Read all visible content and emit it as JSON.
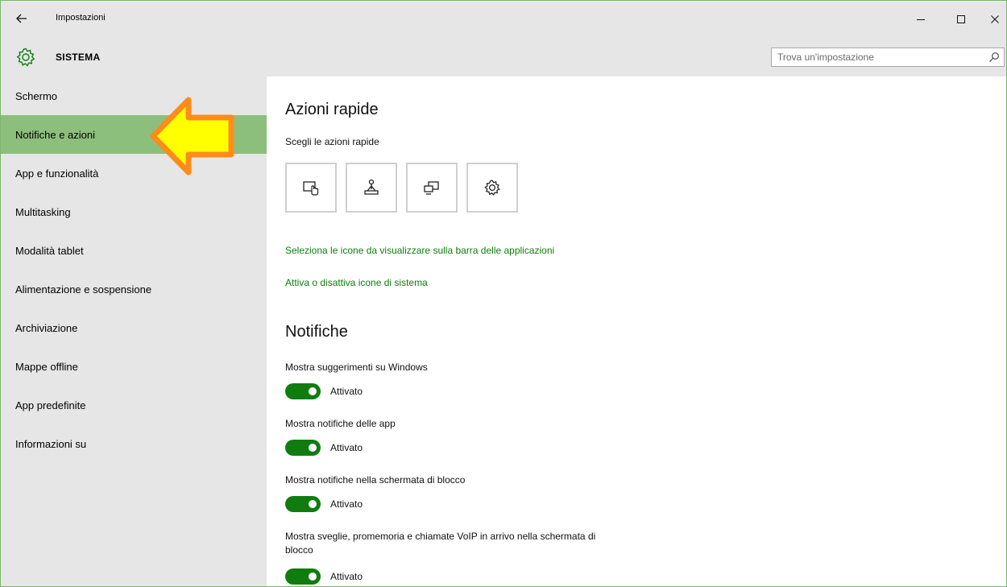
{
  "window": {
    "title": "Impostazioni",
    "controls": {
      "minimize": "–",
      "maximize": "☐",
      "close": "✕"
    }
  },
  "header": {
    "icon": "gear-icon",
    "title": "SISTEMA",
    "search_placeholder": "Trova un'impostazione"
  },
  "sidebar": {
    "items": [
      {
        "label": "Schermo",
        "active": false
      },
      {
        "label": "Notifiche e azioni",
        "active": true
      },
      {
        "label": "App e funzionalità",
        "active": false
      },
      {
        "label": "Multitasking",
        "active": false
      },
      {
        "label": "Modalità tablet",
        "active": false
      },
      {
        "label": "Alimentazione e sospensione",
        "active": false
      },
      {
        "label": "Archiviazione",
        "active": false
      },
      {
        "label": "Mappe offline",
        "active": false
      },
      {
        "label": "App predefinite",
        "active": false
      },
      {
        "label": "Informazioni su",
        "active": false
      }
    ]
  },
  "main": {
    "quick_actions": {
      "heading": "Azioni rapide",
      "subheading": "Scegli le azioni rapide",
      "tiles": [
        {
          "icon": "tablet-mode-icon"
        },
        {
          "icon": "connect-icon"
        },
        {
          "icon": "project-icon"
        },
        {
          "icon": "settings-gear-icon"
        }
      ]
    },
    "links": {
      "taskbar_icons": "Seleziona le icone da visualizzare sulla barra delle applicazioni",
      "system_icons": "Attiva o disattiva icone di sistema"
    },
    "notifications": {
      "heading": "Notifiche",
      "settings": [
        {
          "label": "Mostra suggerimenti su Windows",
          "state": "Attivato",
          "on": true
        },
        {
          "label": "Mostra notifiche delle app",
          "state": "Attivato",
          "on": true
        },
        {
          "label": "Mostra notifiche nella schermata di blocco",
          "state": "Attivato",
          "on": true
        },
        {
          "label": "Mostra sveglie, promemoria e chiamate VoIP in arrivo nella schermata di blocco",
          "state": "Attivato",
          "on": true
        }
      ]
    }
  },
  "colors": {
    "accent": "#107c10",
    "sidebar_active": "#8dbf7c",
    "chrome": "#e6e6e6",
    "arrow_fill": "#ffff00",
    "arrow_stroke": "#ff8c1a"
  }
}
